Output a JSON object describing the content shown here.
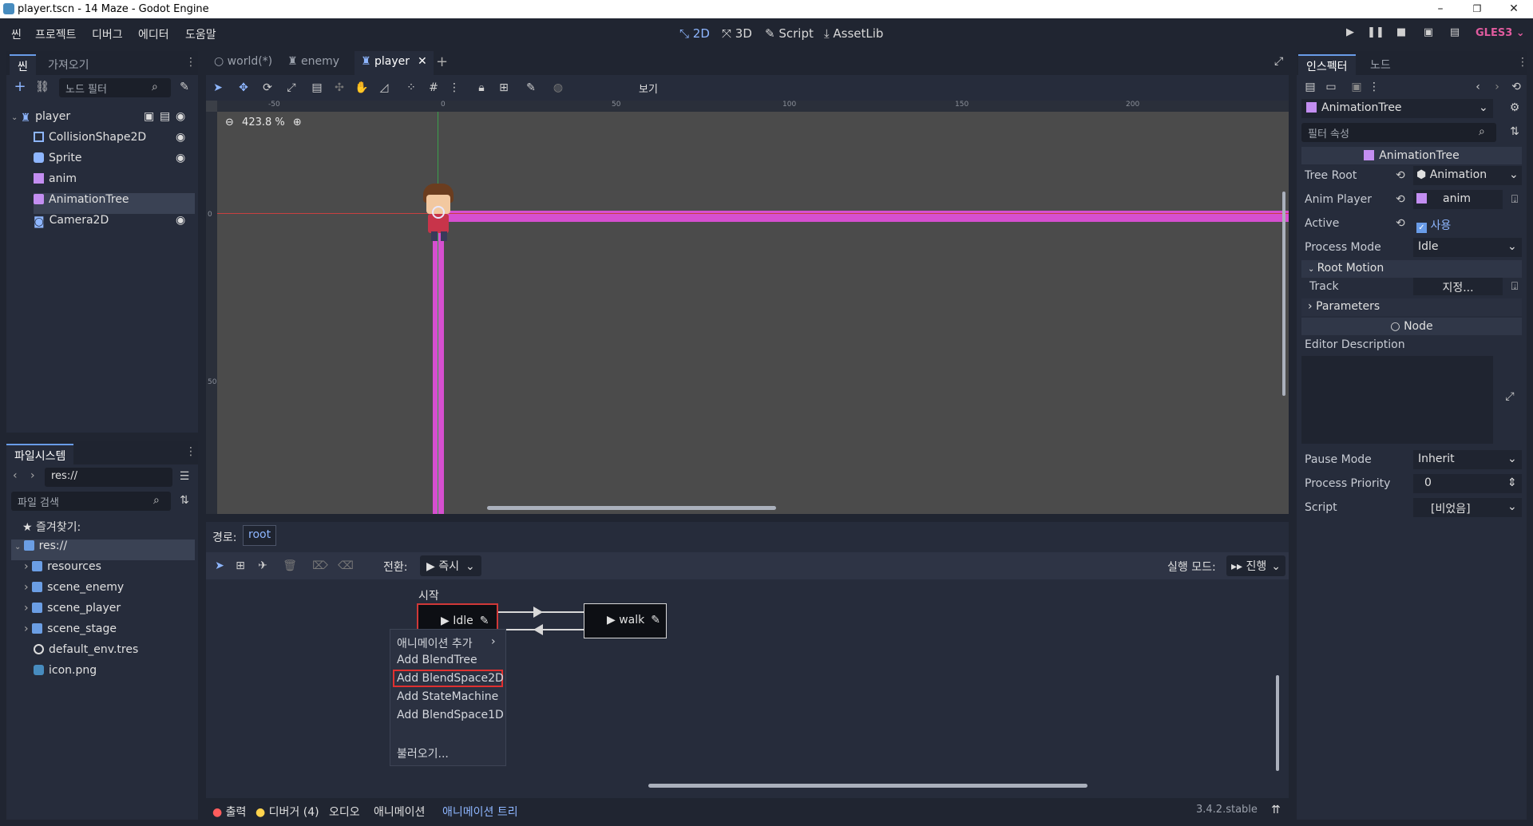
{
  "window": {
    "title": "player.tscn - 14 Maze - Godot Engine",
    "minimize": "–",
    "maximize": "❐",
    "close": "✕"
  },
  "menu": {
    "items": [
      "씬",
      "프로젝트",
      "디버그",
      "에디터",
      "도움말"
    ],
    "workspaces": [
      "2D",
      "3D",
      "Script",
      "AssetLib"
    ],
    "renderer": "GLES3"
  },
  "scene_dock": {
    "tabs": [
      "씬",
      "가져오기"
    ],
    "filter_placeholder": "노드 필터",
    "nodes": [
      "player",
      "CollisionShape2D",
      "Sprite",
      "anim",
      "AnimationTree",
      "Camera2D"
    ]
  },
  "filesystem": {
    "tab": "파일시스템",
    "path": "res://",
    "search_placeholder": "파일 검색",
    "favorites": "즐겨찾기:",
    "root": "res://",
    "items": [
      "resources",
      "scene_enemy",
      "scene_player",
      "scene_stage",
      "default_env.tres",
      "icon.png"
    ]
  },
  "scene_tabs": [
    "world(*)",
    "enemy",
    "player"
  ],
  "viewport": {
    "zoom": "423.8 %",
    "view_menu": "보기",
    "ruler_top": [
      "-50",
      "0",
      "50",
      "100",
      "150",
      "200"
    ],
    "ruler_left": [
      "0",
      "50"
    ]
  },
  "anim_tree": {
    "path_label": "경로:",
    "path_value": "root",
    "transition_label": "전환:",
    "transition_value": "즉시",
    "play_mode_label": "실행 모드:",
    "play_mode_value": "진행",
    "start_label": "시작",
    "node_idle": "Idle",
    "node_walk": "walk"
  },
  "context_menu": {
    "items": [
      "애니메이션 추가",
      "Add BlendTree",
      "Add BlendSpace2D",
      "Add StateMachine",
      "Add BlendSpace1D",
      "불러오기..."
    ],
    "highlighted": "Add BlendSpace2D"
  },
  "bottom_bar": {
    "tabs": [
      "출력",
      "디버거 (4)",
      "오디오",
      "애니메이션",
      "애니메이션 트리"
    ],
    "version": "3.4.2.stable"
  },
  "inspector": {
    "tabs": [
      "인스펙터",
      "노드"
    ],
    "object": "AnimationTree",
    "filter_placeholder": "필터 속성",
    "section": "AnimationTree",
    "tree_root_label": "Tree Root",
    "tree_root_value": "Animation",
    "anim_player_label": "Anim Player",
    "anim_player_value": "anim",
    "active_label": "Active",
    "active_value": "사용",
    "process_mode_label": "Process Mode",
    "process_mode_value": "Idle",
    "root_motion": "Root Motion",
    "track_label": "Track",
    "track_value": "지정...",
    "parameters": "Parameters",
    "node_section": "Node",
    "editor_description": "Editor Description",
    "pause_mode_label": "Pause Mode",
    "pause_mode_value": "Inherit",
    "process_priority_label": "Process Priority",
    "process_priority_value": "0",
    "script_label": "Script",
    "script_value": "[비었음]"
  },
  "colors": {
    "accent": "#699ce8",
    "collision": "#e060d0",
    "highlight_border": "#e03030"
  }
}
